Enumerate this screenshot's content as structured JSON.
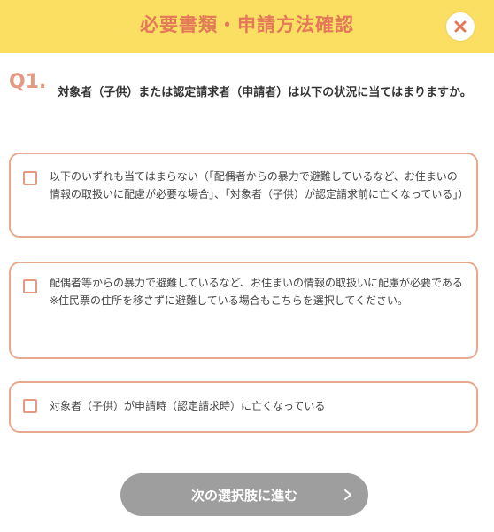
{
  "header": {
    "title": "必要書類・申請方法確認",
    "close_icon": "close-icon"
  },
  "question": {
    "number": "Q1.",
    "text": "対象者（子供）または認定請求者（申請者）は以下の状況に当てはまりますか。"
  },
  "options": [
    {
      "text": "以下のいずれも当てはまらない（「配偶者からの暴力で避難しているなど、お住まいの情報の取扱いに配慮が必要な場合」、「対象者（子供）が認定請求前に亡くなっている」）",
      "checked": false
    },
    {
      "text": "配偶者等からの暴力で避難しているなど、お住まいの情報の取扱いに配慮が必要である",
      "note": "※住民票の住所を移さずに避難している場合もこちらを選択してください。",
      "checked": false
    },
    {
      "text": "対象者（子供）が申請時（認定請求時）に亡くなっている",
      "checked": false
    }
  ],
  "next_button": {
    "label": "次の選択肢に進む",
    "icon": "chevron-right-icon"
  },
  "colors": {
    "header_bg": "#fbdf63",
    "title": "#e4795a",
    "option_border": "#e7a98e",
    "button_bg": "#9e9e9e"
  }
}
